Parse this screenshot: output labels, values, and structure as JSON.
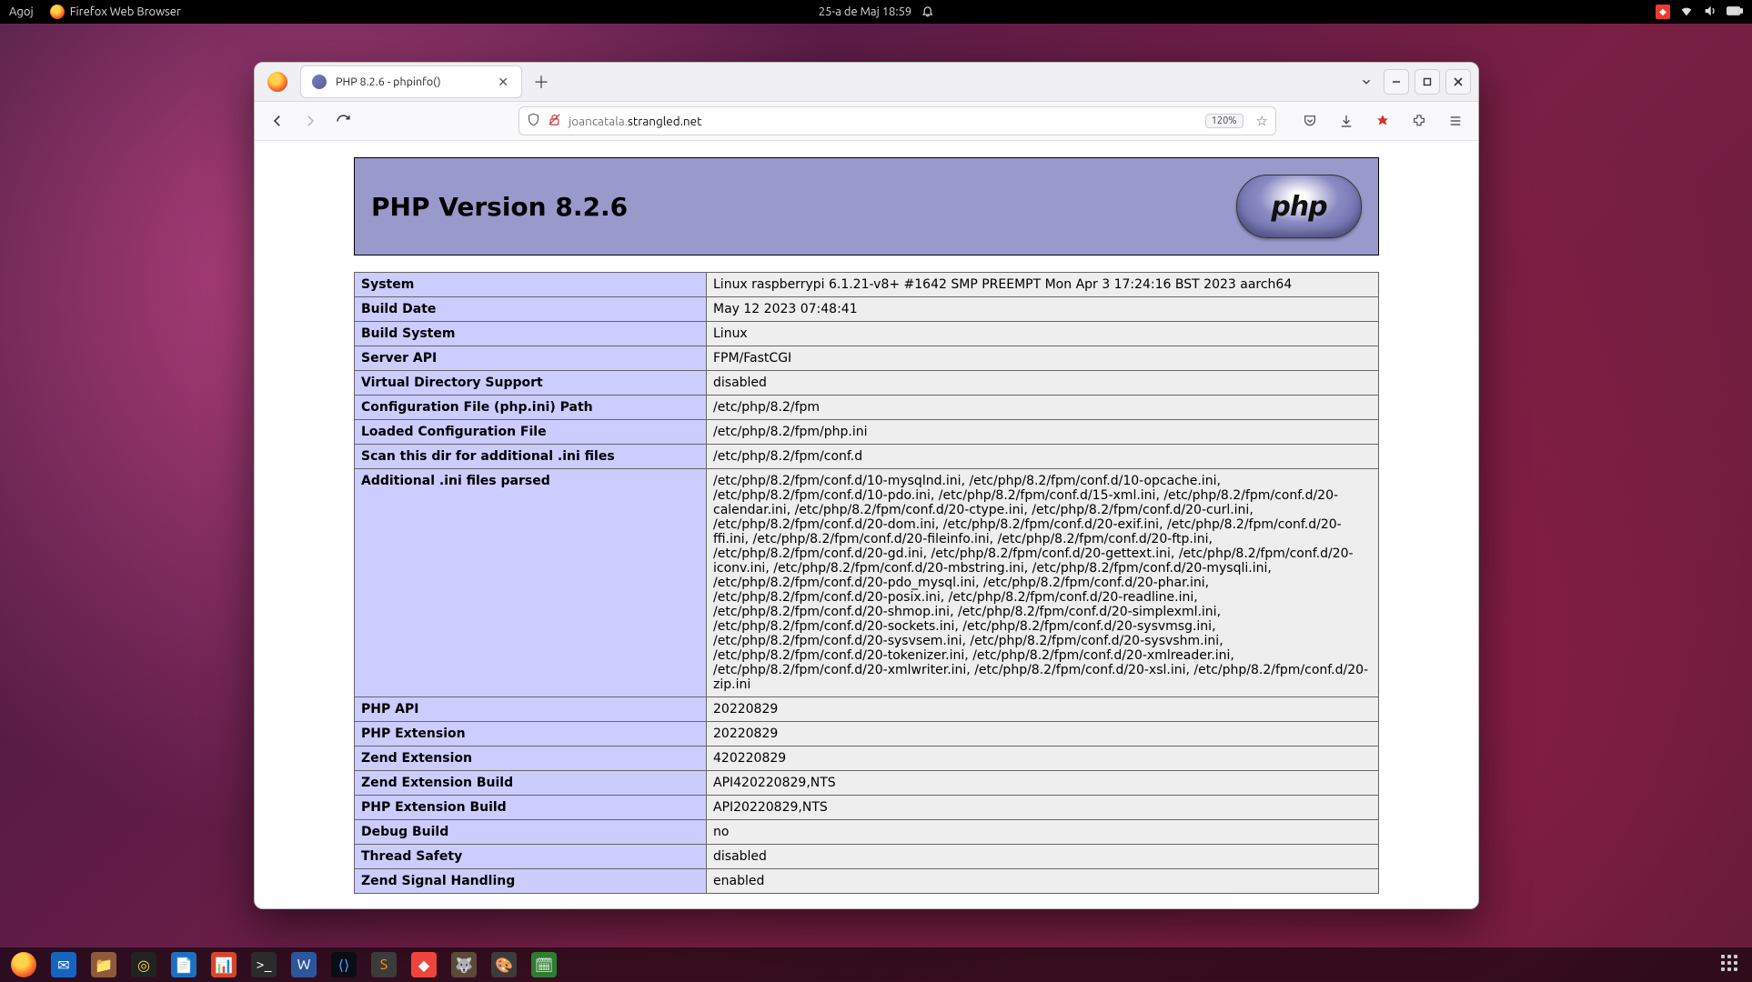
{
  "topbar": {
    "activities": "Agoj",
    "app": "Firefox Web Browser",
    "clock": "25-a de Maj  18:59"
  },
  "tab": {
    "title": "PHP 8.2.6 - phpinfo()"
  },
  "navbar": {
    "url_host": "strangled.net",
    "url_prefix": "joancatala.",
    "zoom": "120%"
  },
  "php": {
    "heading": "PHP Version 8.2.6",
    "logo_text": "php",
    "rows": [
      {
        "k": "System",
        "v": "Linux raspberrypi 6.1.21-v8+ #1642 SMP PREEMPT Mon Apr 3 17:24:16 BST 2023 aarch64"
      },
      {
        "k": "Build Date",
        "v": "May 12 2023 07:48:41"
      },
      {
        "k": "Build System",
        "v": "Linux"
      },
      {
        "k": "Server API",
        "v": "FPM/FastCGI"
      },
      {
        "k": "Virtual Directory Support",
        "v": "disabled"
      },
      {
        "k": "Configuration File (php.ini) Path",
        "v": "/etc/php/8.2/fpm"
      },
      {
        "k": "Loaded Configuration File",
        "v": "/etc/php/8.2/fpm/php.ini"
      },
      {
        "k": "Scan this dir for additional .ini files",
        "v": "/etc/php/8.2/fpm/conf.d"
      },
      {
        "k": "Additional .ini files parsed",
        "v": "/etc/php/8.2/fpm/conf.d/10-mysqlnd.ini, /etc/php/8.2/fpm/conf.d/10-opcache.ini, /etc/php/8.2/fpm/conf.d/10-pdo.ini, /etc/php/8.2/fpm/conf.d/15-xml.ini, /etc/php/8.2/fpm/conf.d/20-calendar.ini, /etc/php/8.2/fpm/conf.d/20-ctype.ini, /etc/php/8.2/fpm/conf.d/20-curl.ini, /etc/php/8.2/fpm/conf.d/20-dom.ini, /etc/php/8.2/fpm/conf.d/20-exif.ini, /etc/php/8.2/fpm/conf.d/20-ffi.ini, /etc/php/8.2/fpm/conf.d/20-fileinfo.ini, /etc/php/8.2/fpm/conf.d/20-ftp.ini, /etc/php/8.2/fpm/conf.d/20-gd.ini, /etc/php/8.2/fpm/conf.d/20-gettext.ini, /etc/php/8.2/fpm/conf.d/20-iconv.ini, /etc/php/8.2/fpm/conf.d/20-mbstring.ini, /etc/php/8.2/fpm/conf.d/20-mysqli.ini, /etc/php/8.2/fpm/conf.d/20-pdo_mysql.ini, /etc/php/8.2/fpm/conf.d/20-phar.ini, /etc/php/8.2/fpm/conf.d/20-posix.ini, /etc/php/8.2/fpm/conf.d/20-readline.ini, /etc/php/8.2/fpm/conf.d/20-shmop.ini, /etc/php/8.2/fpm/conf.d/20-simplexml.ini, /etc/php/8.2/fpm/conf.d/20-sockets.ini, /etc/php/8.2/fpm/conf.d/20-sysvmsg.ini, /etc/php/8.2/fpm/conf.d/20-sysvsem.ini, /etc/php/8.2/fpm/conf.d/20-sysvshm.ini, /etc/php/8.2/fpm/conf.d/20-tokenizer.ini, /etc/php/8.2/fpm/conf.d/20-xmlreader.ini, /etc/php/8.2/fpm/conf.d/20-xmlwriter.ini, /etc/php/8.2/fpm/conf.d/20-xsl.ini, /etc/php/8.2/fpm/conf.d/20-zip.ini"
      },
      {
        "k": "PHP API",
        "v": "20220829"
      },
      {
        "k": "PHP Extension",
        "v": "20220829"
      },
      {
        "k": "Zend Extension",
        "v": "420220829"
      },
      {
        "k": "Zend Extension Build",
        "v": "API420220829,NTS"
      },
      {
        "k": "PHP Extension Build",
        "v": "API20220829,NTS"
      },
      {
        "k": "Debug Build",
        "v": "no"
      },
      {
        "k": "Thread Safety",
        "v": "disabled"
      },
      {
        "k": "Zend Signal Handling",
        "v": "enabled"
      }
    ]
  },
  "dock": [
    {
      "name": "firefox",
      "bg": "#1d1235",
      "glyph": "",
      "grad": "radial-gradient(circle at 40% 35%,#ffd24a 0 30%,#ff7f2a 55%,#e2392d 80%)"
    },
    {
      "name": "thunderbird",
      "bg": "#1565c0",
      "glyph": "✉"
    },
    {
      "name": "files",
      "bg": "#8d5a3b",
      "glyph": "📁"
    },
    {
      "name": "rhythmbox",
      "bg": "#222",
      "glyph": "◎",
      "fg": "#f7d94c"
    },
    {
      "name": "libreoffice-writer",
      "bg": "#1e70bf",
      "glyph": "📄"
    },
    {
      "name": "libreoffice-impress",
      "bg": "#d9452b",
      "glyph": "📊"
    },
    {
      "name": "terminal",
      "bg": "#2b2b2b",
      "glyph": ">_"
    },
    {
      "name": "word-like",
      "bg": "#2b579a",
      "glyph": "W"
    },
    {
      "name": "vscode",
      "bg": "#0b0d16",
      "glyph": "⟨⟩",
      "fg": "#3ea6ff"
    },
    {
      "name": "sublime",
      "bg": "#3b3b3b",
      "glyph": "S",
      "fg": "#ff9800"
    },
    {
      "name": "anydesk",
      "bg": "#ef443b",
      "glyph": "◆"
    },
    {
      "name": "gimp",
      "bg": "#5a4a3a",
      "glyph": "🐺"
    },
    {
      "name": "color-picker",
      "bg": "#3c3c3c",
      "glyph": "🎨"
    },
    {
      "name": "calculator",
      "bg": "#2e7d32",
      "glyph": "🗓"
    }
  ]
}
